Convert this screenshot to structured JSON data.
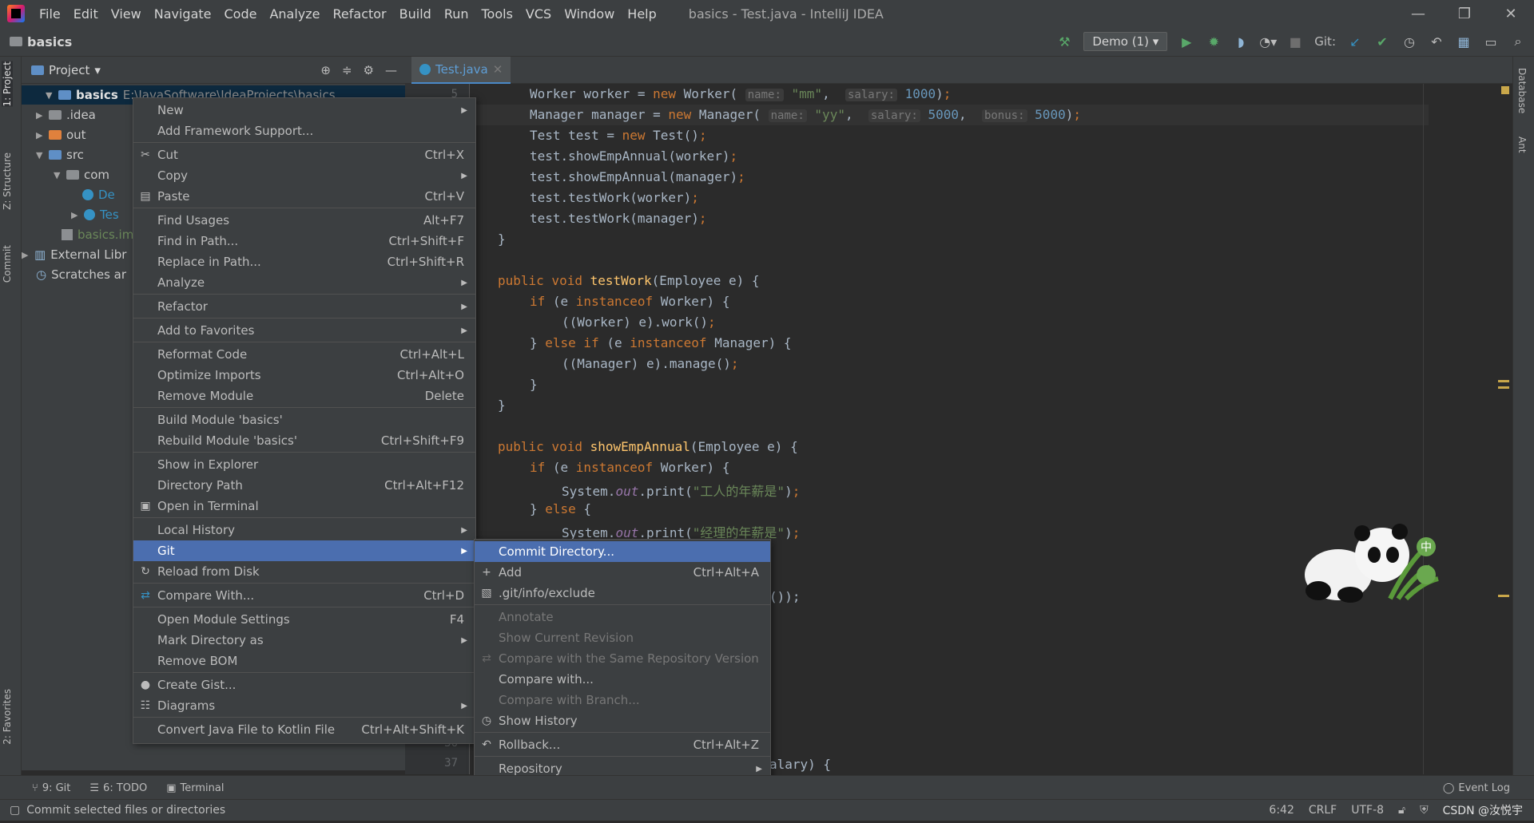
{
  "window": {
    "title": "basics - Test.java - IntelliJ IDEA",
    "menu": [
      "File",
      "Edit",
      "View",
      "Navigate",
      "Code",
      "Analyze",
      "Refactor",
      "Build",
      "Run",
      "Tools",
      "VCS",
      "Window",
      "Help"
    ],
    "controls": {
      "minimize": "—",
      "restore": "❐",
      "close": "✕"
    }
  },
  "navbar": {
    "breadcrumb": "basics",
    "run_config": "Demo (1)",
    "git_label": "Git:"
  },
  "left_stripe": {
    "project": "1: Project",
    "structure": "Z: Structure",
    "commit": "Commit",
    "favorites": "2: Favorites"
  },
  "right_stripe": {
    "database": "Database",
    "ant": "Ant"
  },
  "project_panel": {
    "title": "Project",
    "tree": {
      "root_name": "basics",
      "root_path": "E:\\JavaSoftware\\IdeaProjects\\basics",
      "idea": ".idea",
      "out": "out",
      "src": "src",
      "com": "com",
      "class1": "De",
      "class2": "Tes",
      "iml": "basics.im",
      "ext": "External Libr",
      "scratches": "Scratches ar"
    }
  },
  "editor": {
    "tab_label": "Test.java",
    "line_numbers": {
      "top": "5",
      "n36": "36",
      "n37": "37"
    },
    "code_tail": {
      "l1": "());",
      "l2": "alary) {"
    }
  },
  "context_menu": {
    "new": "New",
    "add_framework": "Add Framework Support...",
    "cut": "Cut",
    "cut_sc": "Ctrl+X",
    "copy": "Copy",
    "paste": "Paste",
    "paste_sc": "Ctrl+V",
    "find_usages": "Find Usages",
    "find_usages_sc": "Alt+F7",
    "find_in_path": "Find in Path...",
    "find_in_path_sc": "Ctrl+Shift+F",
    "replace_in_path": "Replace in Path...",
    "replace_in_path_sc": "Ctrl+Shift+R",
    "analyze": "Analyze",
    "refactor": "Refactor",
    "add_favorites": "Add to Favorites",
    "reformat": "Reformat Code",
    "reformat_sc": "Ctrl+Alt+L",
    "optimize": "Optimize Imports",
    "optimize_sc": "Ctrl+Alt+O",
    "remove_module": "Remove Module",
    "remove_module_sc": "Delete",
    "build_module": "Build Module 'basics'",
    "rebuild_module": "Rebuild Module 'basics'",
    "rebuild_module_sc": "Ctrl+Shift+F9",
    "show_explorer": "Show in Explorer",
    "directory_path": "Directory Path",
    "directory_path_sc": "Ctrl+Alt+F12",
    "open_terminal": "Open in Terminal",
    "local_history": "Local History",
    "git": "Git",
    "reload": "Reload from Disk",
    "compare_with": "Compare With...",
    "compare_with_sc": "Ctrl+D",
    "module_settings": "Open Module Settings",
    "module_settings_sc": "F4",
    "mark_directory": "Mark Directory as",
    "remove_bom": "Remove BOM",
    "create_gist": "Create Gist...",
    "diagrams": "Diagrams",
    "convert_kotlin": "Convert Java File to Kotlin File",
    "convert_kotlin_sc": "Ctrl+Alt+Shift+K"
  },
  "git_submenu": {
    "commit_dir": "Commit Directory...",
    "add": "Add",
    "add_sc": "Ctrl+Alt+A",
    "exclude": ".git/info/exclude",
    "annotate": "Annotate",
    "show_current": "Show Current Revision",
    "compare_same": "Compare with the Same Repository Version",
    "compare_with": "Compare with...",
    "compare_branch": "Compare with Branch...",
    "show_history": "Show History",
    "rollback": "Rollback...",
    "rollback_sc": "Ctrl+Alt+Z",
    "repository": "Repository"
  },
  "bottom_tools": {
    "git": "9: Git",
    "todo": "6: TODO",
    "terminal": "Terminal",
    "event_log": "Event Log"
  },
  "status": {
    "message": "Commit selected files or directories",
    "position": "6:42",
    "line_sep": "CRLF",
    "encoding": "UTF-8",
    "watermark": "CSDN @汝悦宇"
  },
  "colors": {
    "selection": "#4b6eaf",
    "keyword": "#cc7832",
    "method": "#ffc66d",
    "string": "#6a8759",
    "number": "#6897bb"
  }
}
